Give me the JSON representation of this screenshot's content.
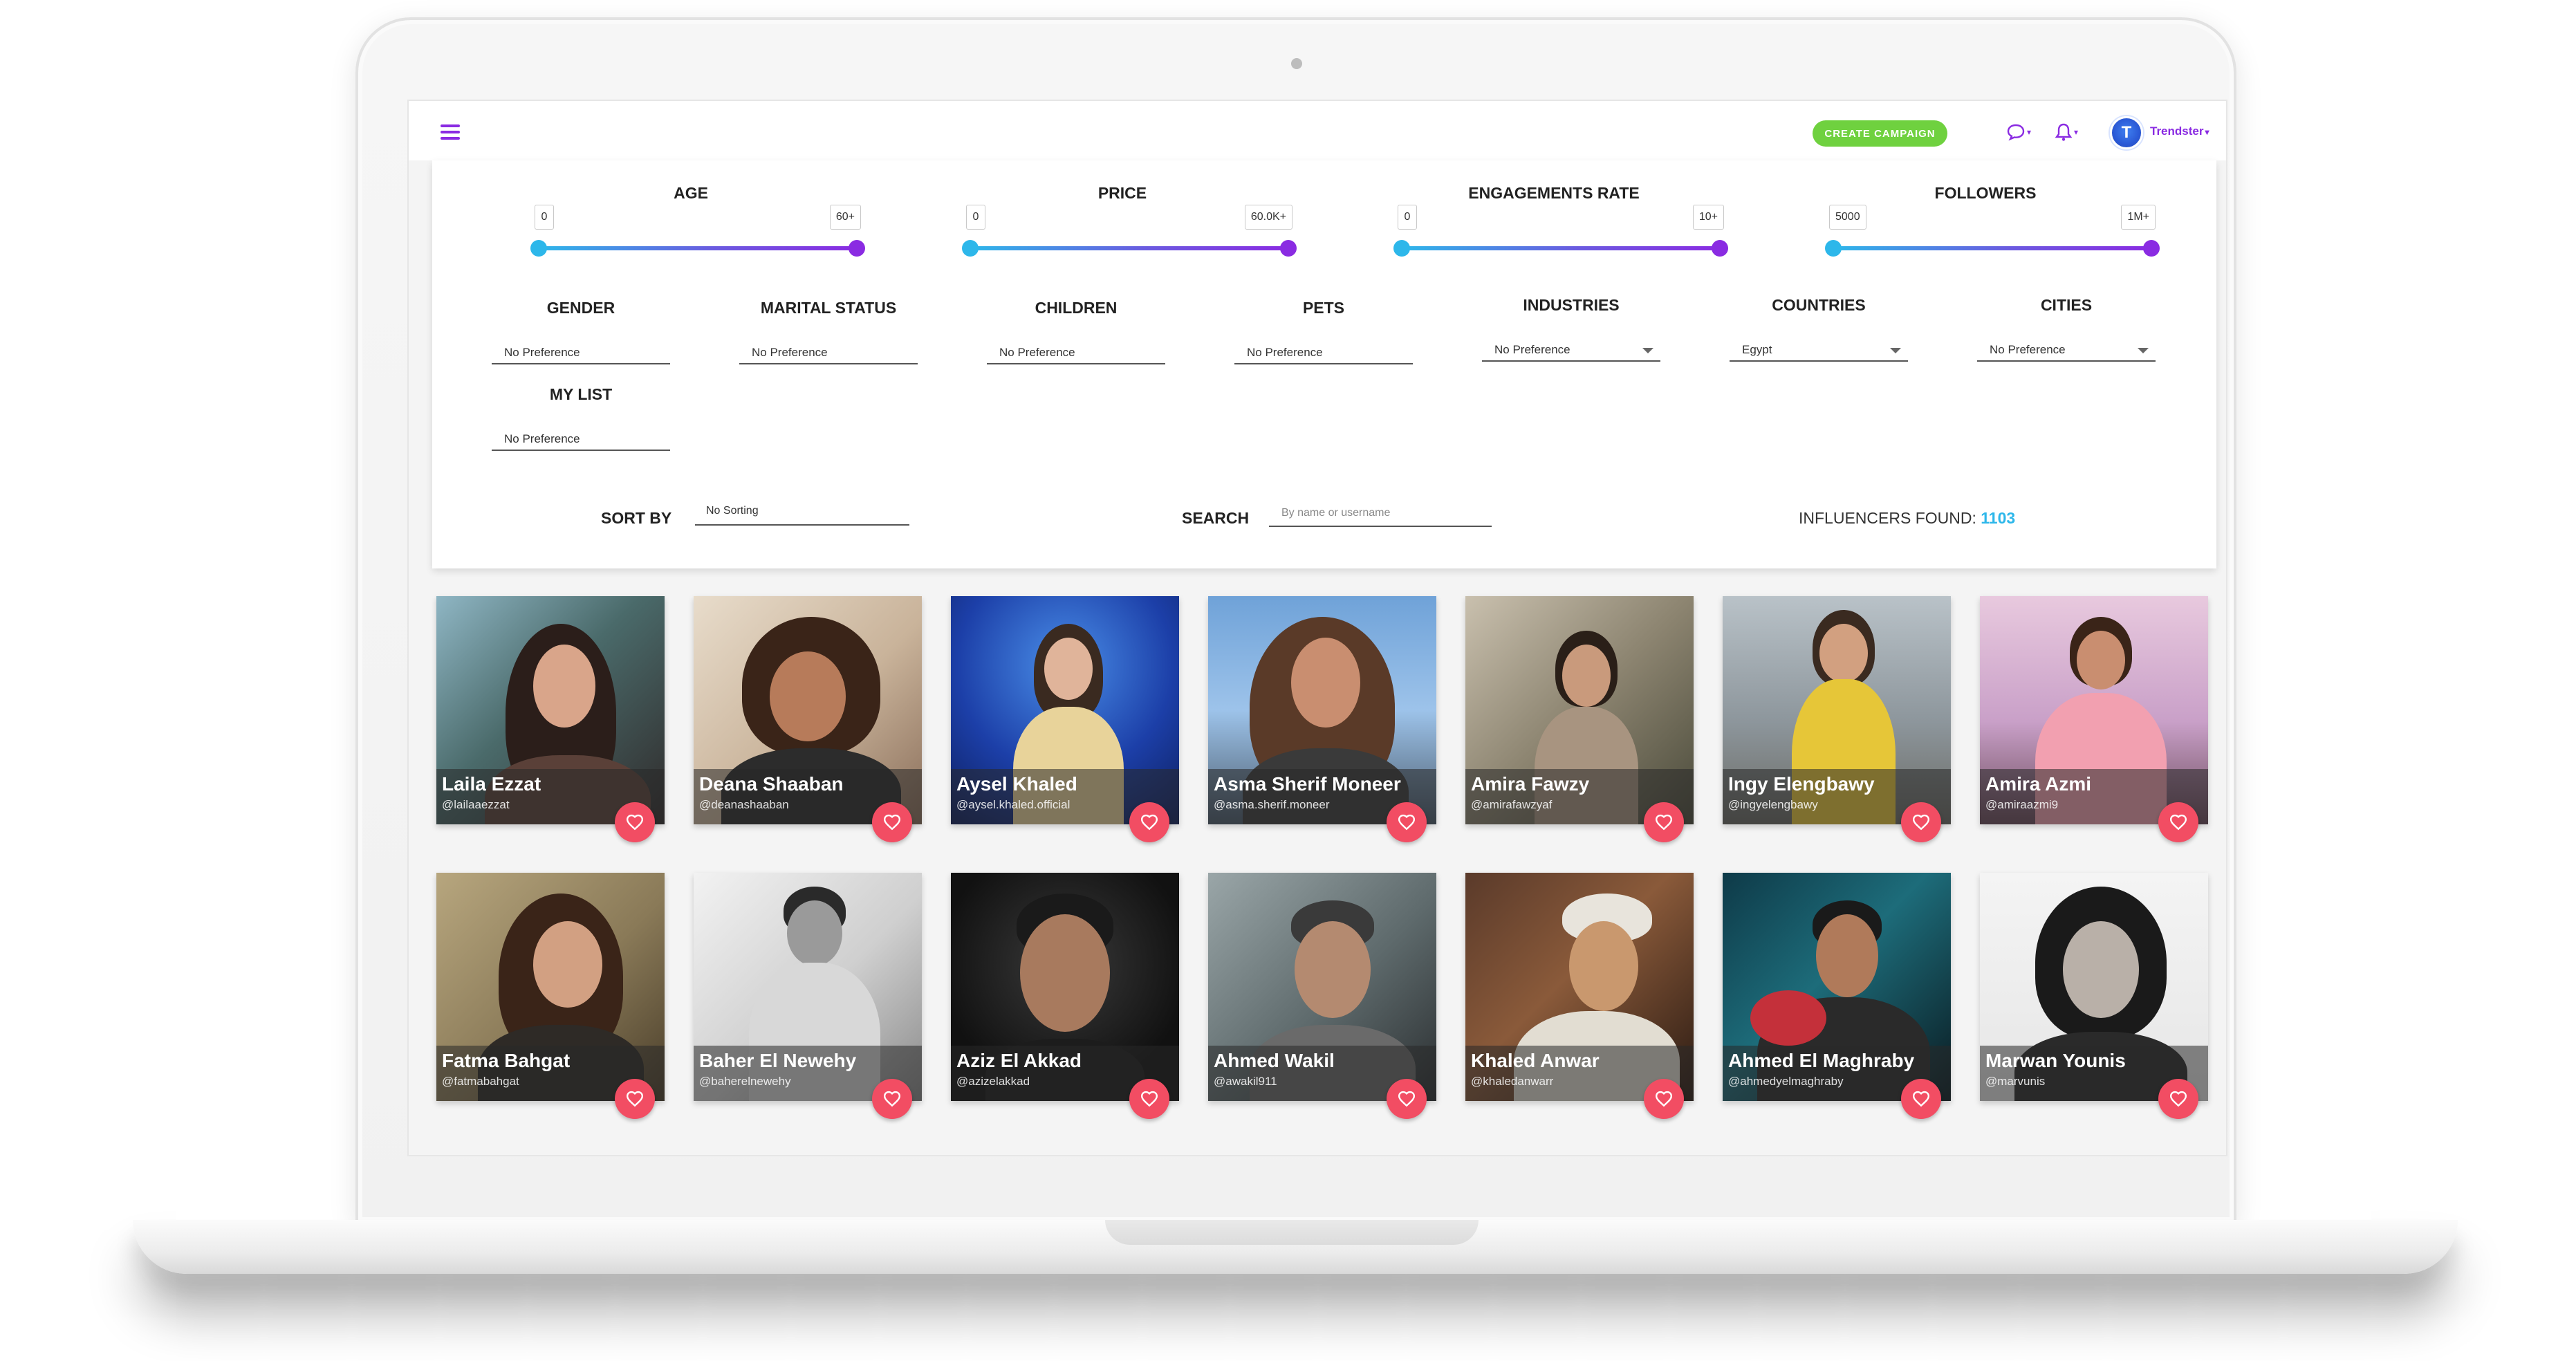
{
  "app": {
    "create_campaign_label": "CREATE CAMPAIGN",
    "brand_name": "Trendster",
    "brand_initial": "T",
    "accent_color": "#8a2be2",
    "success_color": "#6fd13f",
    "heart_color": "#f24d63",
    "icons": [
      "menu-icon",
      "chat-icon",
      "bell-icon",
      "heart-icon",
      "chevron-down-icon"
    ]
  },
  "ranges": [
    {
      "title": "AGE",
      "min": "0",
      "max": "60+"
    },
    {
      "title": "PRICE",
      "min": "0",
      "max": "60.0K+"
    },
    {
      "title": "ENGAGEMENTS RATE",
      "min": "0",
      "max": "10+"
    },
    {
      "title": "FOLLOWERS",
      "min": "5000",
      "max": "1M+"
    }
  ],
  "selects": [
    {
      "title": "GENDER",
      "value": "No Preference"
    },
    {
      "title": "MARITAL STATUS",
      "value": "No Preference"
    },
    {
      "title": "CHILDREN",
      "value": "No Preference"
    },
    {
      "title": "PETS",
      "value": "No Preference"
    },
    {
      "title": "INDUSTRIES",
      "value": "No Preference"
    },
    {
      "title": "COUNTRIES",
      "value": "Egypt"
    },
    {
      "title": "CITIES",
      "value": "No Preference"
    },
    {
      "title": "MY LIST",
      "value": "No Preference"
    }
  ],
  "sort": {
    "label": "SORT BY",
    "value": "No Sorting"
  },
  "search": {
    "label": "SEARCH",
    "placeholder": "By name or username"
  },
  "found": {
    "label": "INFLUENCERS FOUND:",
    "count": "1103"
  },
  "influencers": [
    {
      "name": "Laila Ezzat",
      "username": "@lailaaezzat"
    },
    {
      "name": "Deana Shaaban",
      "username": "@deanashaaban"
    },
    {
      "name": "Aysel Khaled",
      "username": "@aysel.khaled.official"
    },
    {
      "name": "Asma Sherif Moneer",
      "username": "@asma.sherif.moneer"
    },
    {
      "name": "Amira Fawzy",
      "username": "@amirafawzyaf"
    },
    {
      "name": "Ingy Elengbawy",
      "username": "@ingyelengbawy"
    },
    {
      "name": "Amira Azmi",
      "username": "@amiraazmi9"
    },
    {
      "name": "Fatma Bahgat",
      "username": "@fatmabahgat"
    },
    {
      "name": "Baher El Newehy",
      "username": "@baherelnewehy"
    },
    {
      "name": "Aziz El Akkad",
      "username": "@azizelakkad"
    },
    {
      "name": "Ahmed Wakil",
      "username": "@awakil911"
    },
    {
      "name": "Khaled Anwar",
      "username": "@khaledanwarr"
    },
    {
      "name": "Ahmed El Maghraby",
      "username": "@ahmedyelmaghraby"
    },
    {
      "name": "Marwan Younis",
      "username": "@marvunis"
    }
  ]
}
